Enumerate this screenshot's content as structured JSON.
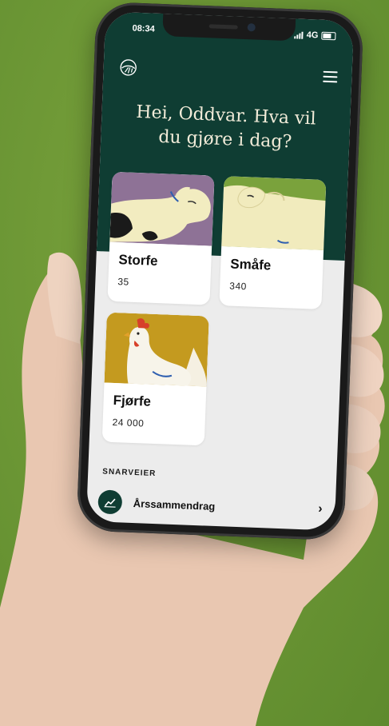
{
  "status_bar": {
    "time": "08:34",
    "network": "4G"
  },
  "header": {
    "logo_icon": "farm-logo-icon",
    "menu_icon": "hamburger-menu-icon",
    "greeting": "Hei, Oddvar. Hva vil du gjøre i dag?"
  },
  "categories": [
    {
      "title": "Storfe",
      "count": "35",
      "image": "cow-illustration",
      "bg_color": "#8e7296"
    },
    {
      "title": "Småfe",
      "count": "340",
      "image": "sheep-illustration",
      "bg_color": "#7aa23c"
    },
    {
      "title": "Fjørfe",
      "count": "24 000",
      "image": "chicken-illustration",
      "bg_color": "#c49a1f"
    }
  ],
  "shortcuts": {
    "heading": "SNARVEIER",
    "items": [
      {
        "label": "Årssammendrag",
        "icon": "line-chart-icon",
        "chevron": "›"
      }
    ]
  },
  "colors": {
    "brand_dark_green": "#0f3d33",
    "background_green": "#6a9534",
    "cream_text": "#f2ecd9"
  }
}
